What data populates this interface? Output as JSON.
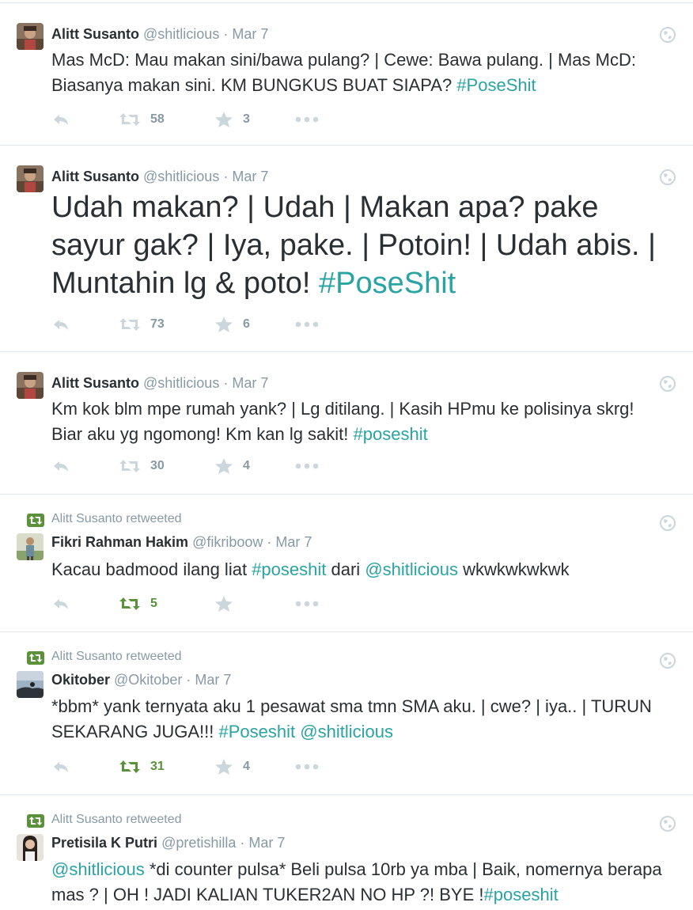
{
  "colors": {
    "hashtag": "#2aa3a3",
    "meta_text": "#8899a6",
    "action_icon": "#ccd6dd",
    "retweeted_green": "#5c913b",
    "divider": "#e1e8ed"
  },
  "icons": {
    "reply": "reply-icon",
    "retweet": "retweet-icon",
    "favorite": "star-icon",
    "more": "more-dots-icon",
    "globe": "globe-icon"
  },
  "tweets": [
    {
      "fullname": "Alitt Susanto",
      "username": "@shitlicious",
      "separator": "·",
      "time": "Mar 7",
      "text_parts": [
        "Mas McD: Mau makan sini/bawa pulang? | Cewe: Bawa pulang. | Mas McD: Biasanya makan sini. KM BUNGKUS BUAT SIAPA?",
        "#PoseShit"
      ],
      "retweets": "58",
      "favorites": "3"
    },
    {
      "fullname": "Alitt Susanto",
      "username": "@shitlicious",
      "separator": "·",
      "time": "Mar 7",
      "text_parts": [
        "Udah makan? | Udah | Makan apa? pake sayur gak? | Iya, pake. | Potoin! | Udah abis. | Muntahin lg & poto!",
        "#PoseShit"
      ],
      "retweets": "73",
      "favorites": "6"
    },
    {
      "fullname": "Alitt Susanto",
      "username": "@shitlicious",
      "separator": "·",
      "time": "Mar 7",
      "text_parts": [
        "Km kok blm mpe rumah yank? | Lg ditilang. | Kasih HPmu ke polisinya skrg! Biar aku yg ngomong! Km kan lg sakit!",
        "#poseshit"
      ],
      "retweets": "30",
      "favorites": "4"
    },
    {
      "retweeted_by": "Alitt Susanto retweeted",
      "fullname": "Fikri Rahman Hakim",
      "username": "@fikriboow",
      "separator": "·",
      "time": "Mar 7",
      "text_parts": [
        "Kacau badmood ilang liat",
        "#poseshit",
        "dari",
        "@shitlicious",
        "wkwkwkwkwk"
      ],
      "retweets": "5",
      "retweeted": true
    },
    {
      "retweeted_by": "Alitt Susanto retweeted",
      "fullname": "Okitober",
      "username": "@Okitober",
      "separator": "·",
      "time": "Mar 7",
      "text_parts": [
        "*bbm* yank ternyata aku 1 pesawat sma tmn SMA aku. | cwe? | iya.. | TURUN SEKARANG JUGA!!!",
        "#Poseshit",
        "@shitlicious"
      ],
      "retweets": "31",
      "favorites": "4",
      "retweeted": true
    },
    {
      "retweeted_by": "Alitt Susanto retweeted",
      "fullname": "Pretisila K Putri",
      "username": "@pretishilla",
      "separator": "·",
      "time": "Mar 7",
      "text_parts": [
        "@shitlicious",
        "*di counter pulsa* Beli pulsa 10rb ya mba | Baik, nomernya berapa mas ? | OH ! JADI KALIAN TUKER2AN NO HP ?! BYE !",
        "#poseshit"
      ]
    }
  ]
}
